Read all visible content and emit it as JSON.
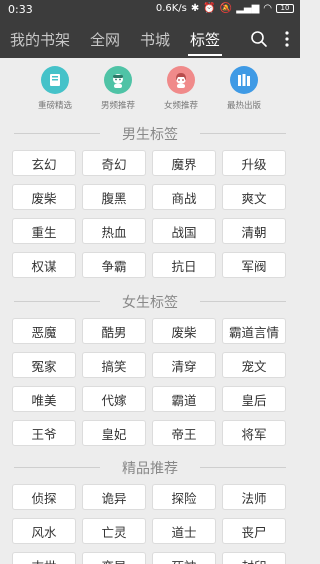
{
  "status_bar": {
    "time": "0:33",
    "network_speed": "0.6K/s",
    "battery": "10"
  },
  "nav": {
    "tabs": [
      "我的书架",
      "全网",
      "书城",
      "标签"
    ],
    "active_tab": "标签"
  },
  "categories": [
    {
      "label": "重磅精选",
      "color": "#45c2c9",
      "icon": "book-icon"
    },
    {
      "label": "男频推荐",
      "color": "#4fc3a6",
      "icon": "boy-avatar-icon"
    },
    {
      "label": "女频推荐",
      "color": "#f08a8a",
      "icon": "girl-avatar-icon"
    },
    {
      "label": "最热出版",
      "color": "#3f9ae5",
      "icon": "books-icon"
    }
  ],
  "sections": [
    {
      "title": "男生标签",
      "tags": [
        "玄幻",
        "奇幻",
        "魔界",
        "升级",
        "废柴",
        "腹黑",
        "商战",
        "爽文",
        "重生",
        "热血",
        "战国",
        "清朝",
        "权谋",
        "争霸",
        "抗日",
        "军阀"
      ]
    },
    {
      "title": "女生标签",
      "tags": [
        "恶魔",
        "酷男",
        "废柴",
        "霸道言情",
        "冤家",
        "搞笑",
        "清穿",
        "宠文",
        "唯美",
        "代嫁",
        "霸道",
        "皇后",
        "王爷",
        "皇妃",
        "帝王",
        "将军"
      ]
    },
    {
      "title": "精品推荐",
      "tags": [
        "侦探",
        "诡异",
        "探险",
        "法师",
        "风水",
        "亡灵",
        "道士",
        "丧尸",
        "末世",
        "变异",
        "死神",
        "封印"
      ]
    }
  ]
}
